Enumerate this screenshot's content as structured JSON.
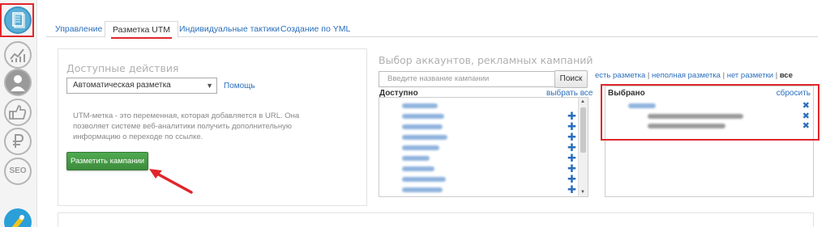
{
  "sidebar": {
    "icons": [
      "documents-icon",
      "chart-growth-icon",
      "user-icon",
      "thumbs-up-icon",
      "ruble-icon",
      "seo-icon",
      "logo-icon"
    ],
    "seo_text": "SEO"
  },
  "tabs": [
    {
      "label": "Управление",
      "active": false
    },
    {
      "label": "Разметка UTM",
      "active": true
    },
    {
      "label": "Индивидуальные тактики",
      "active": false
    },
    {
      "label": "Создание по YML",
      "active": false
    }
  ],
  "actions": {
    "title": "Доступные действия",
    "select_value": "Автоматическая разметка",
    "help_link": "Помощь",
    "description": "UTM-метка - это переменная, которая добавляется в URL. Она позволяет системе веб-аналитики получить дополнительную информацию о переходе по ссылке.",
    "button": "Разметить кампании"
  },
  "accounts": {
    "title": "Выбор аккаунтов, рекламных кампаний",
    "search_placeholder": "Введите название кампании",
    "search_button": "Поиск",
    "available_label": "Доступно",
    "select_all": "выбрать все",
    "filters": [
      "есть разметка",
      "неполная разметка",
      "нет разметки",
      "все"
    ],
    "selected_label": "Выбрано",
    "reset": "сбросить"
  },
  "colors": {
    "accent_red": "#e0262b",
    "link_blue": "#2a6ebb",
    "button_green": "#3d8b3d"
  }
}
